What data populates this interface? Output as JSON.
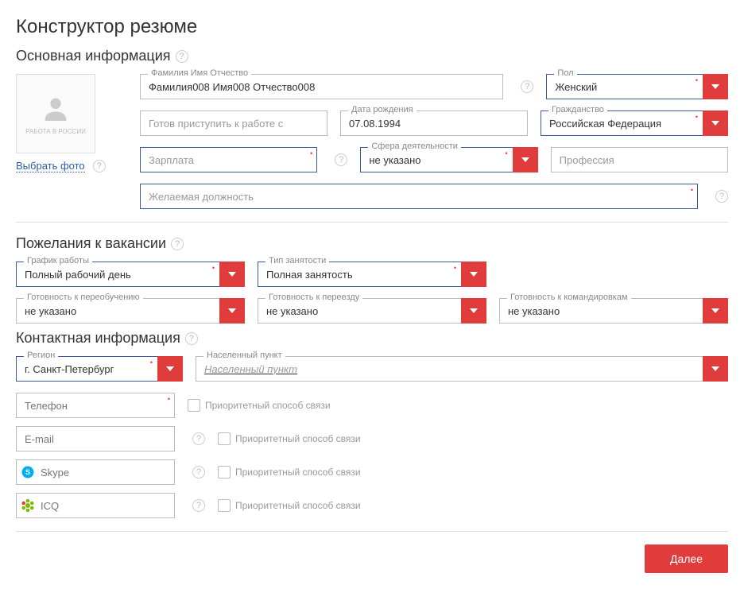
{
  "page_title": "Конструктор резюме",
  "sections": {
    "basic": "Основная информация",
    "wishes": "Пожелания к вакансии",
    "contacts": "Контактная информация"
  },
  "photo": {
    "caption": "РАБОТА В РОССИИ",
    "choose": "Выбрать фото"
  },
  "fields": {
    "fio_label": "Фамилия Имя Отчество",
    "fio_value": "Фамилия008 Имя008 Отчество008",
    "gender_label": "Пол",
    "gender_value": "Женский",
    "start_placeholder": "Готов приступить к работе с",
    "dob_label": "Дата рождения",
    "dob_value": "07.08.1994",
    "citizenship_label": "Гражданство",
    "citizenship_value": "Российская Федерация",
    "salary_placeholder": "Зарплата",
    "sphere_label": "Сфера деятельности",
    "sphere_value": "не указано",
    "profession_placeholder": "Профессия",
    "position_placeholder": "Желаемая должность",
    "schedule_label": "График работы",
    "schedule_value": "Полный рабочий день",
    "emptype_label": "Тип занятости",
    "emptype_value": "Полная занятость",
    "retrain_label": "Готовность к переобучению",
    "retrain_value": "не указано",
    "relocate_label": "Готовность к переезду",
    "relocate_value": "не указано",
    "trips_label": "Готовность к командировкам",
    "trips_value": "не указано",
    "region_label": "Регион",
    "region_value": "г. Санкт-Петербург",
    "locality_label": "Населенный пункт",
    "locality_placeholder": "Населенный пункт",
    "phone_placeholder": "Телефон",
    "email_placeholder": "E-mail",
    "skype_placeholder": "Skype",
    "icq_placeholder": "ICQ",
    "priority_label": "Приоритетный способ связи"
  },
  "buttons": {
    "next": "Далее"
  },
  "help_glyph": "?"
}
